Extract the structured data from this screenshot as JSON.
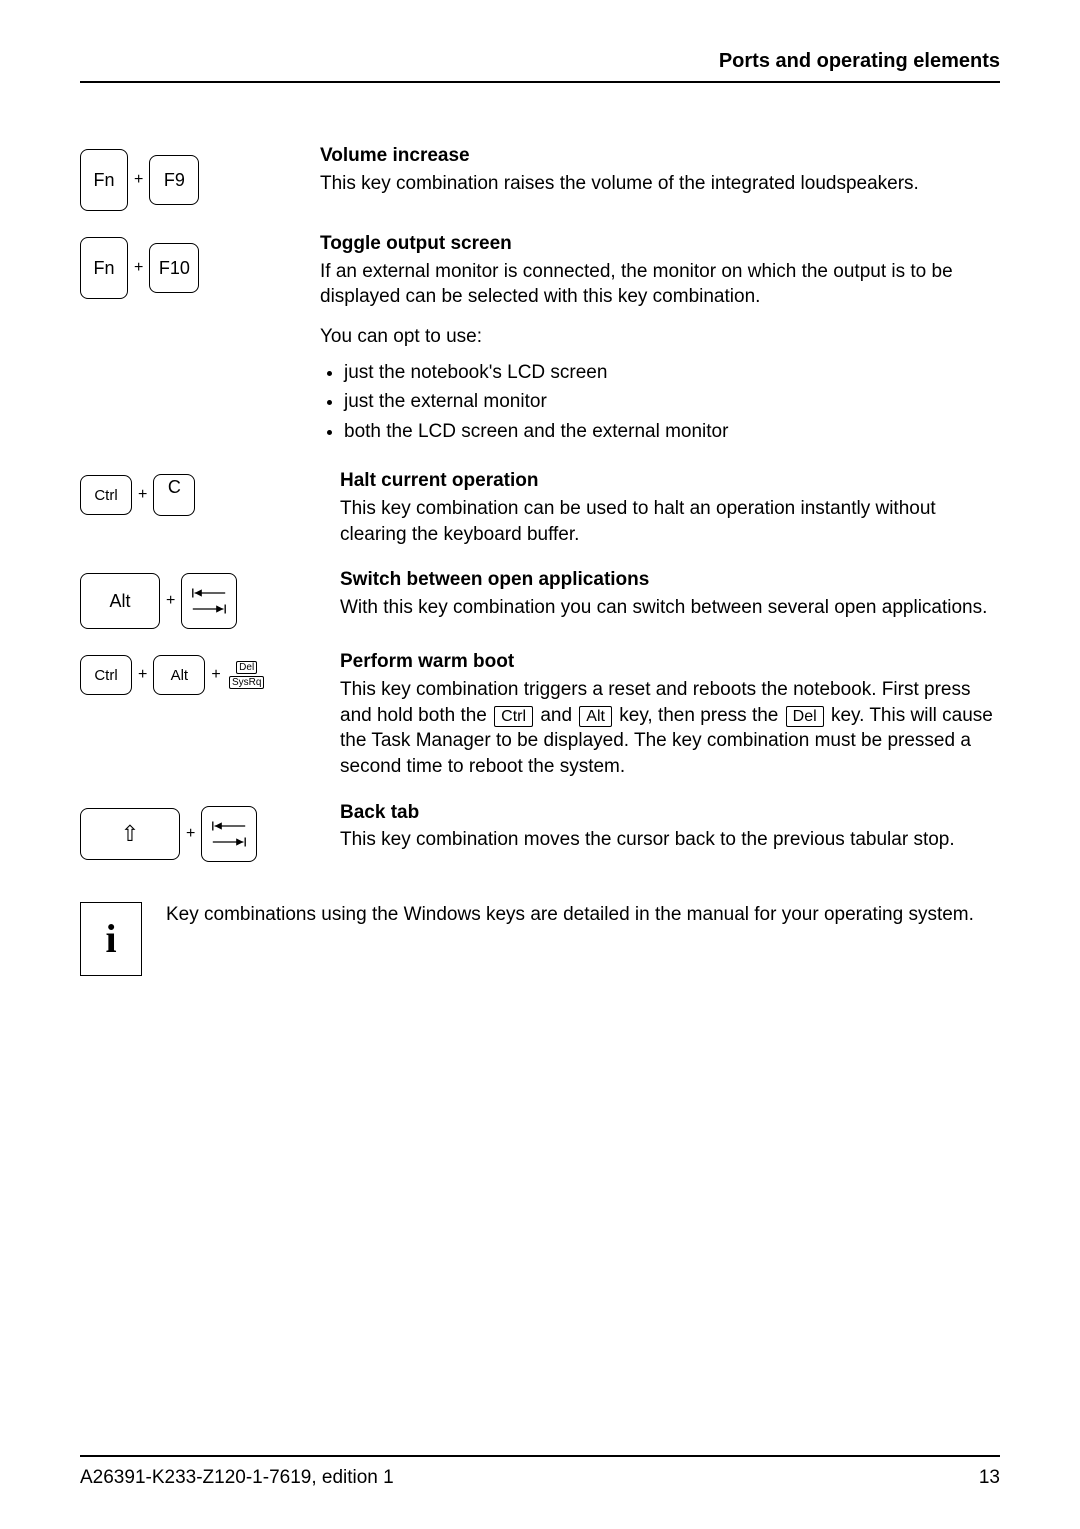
{
  "header": {
    "title": "Ports and operating elements"
  },
  "keys": {
    "fn": "Fn",
    "f9": "F9",
    "f10": "F10",
    "ctrl": "Ctrl",
    "alt": "Alt",
    "c": "C",
    "del": "Del",
    "sysrq": "SysRq",
    "plus": "+"
  },
  "inline_keys": {
    "ctrl": "Ctrl",
    "alt": "Alt",
    "del": "Del"
  },
  "sec1": {
    "title": "Volume increase",
    "body": "This key combination raises the volume of the integrated loudspeakers."
  },
  "sec2": {
    "title": "Toggle output screen",
    "body": "If an external monitor is connected, the monitor on which the output is to be displayed can be selected with this key combination.",
    "opt_intro": "You can opt to use:",
    "opts": {
      "a": "just the notebook's LCD screen",
      "b": "just the external monitor",
      "c": "both the LCD screen and the external monitor"
    }
  },
  "sec3": {
    "title": "Halt current operation",
    "body": "This key combination can be used to halt an operation instantly without clearing the keyboard buffer."
  },
  "sec4": {
    "title": "Switch between open applications",
    "body": "With this key combination you can switch between several open applications."
  },
  "sec5": {
    "title": "Perform warm boot",
    "pre": "This key combination triggers a reset and reboots the notebook. First press and hold both the ",
    "mid1": " and ",
    "mid2": " key, then press the ",
    "post": " key. This will cause the Task Manager to be displayed. The key combination must be pressed a second time to reboot the system."
  },
  "sec6": {
    "title": "Back tab",
    "body": "This key combination moves the cursor back to the previous tabular stop."
  },
  "info": {
    "text": "Key combinations using the Windows keys are detailed in the manual for your operating system."
  },
  "footer": {
    "left": "A26391-K233-Z120-1-7619, edition 1",
    "right": "13"
  }
}
